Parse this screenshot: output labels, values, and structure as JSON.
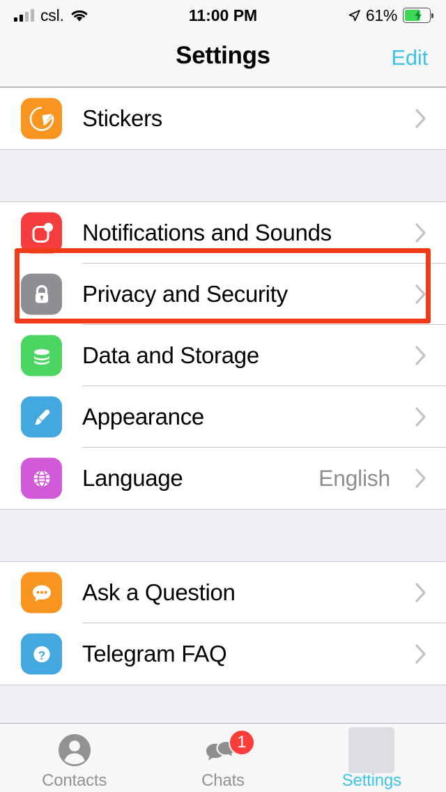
{
  "status_bar": {
    "carrier": "csl.",
    "time": "11:00 PM",
    "battery_percent": "61%",
    "signal_bars_filled": 2,
    "signal_bars_total": 4,
    "icons": [
      "signal-bars-icon",
      "wifi-icon",
      "location-arrow-icon",
      "battery-charging-icon"
    ]
  },
  "nav": {
    "title": "Settings",
    "edit_label": "Edit",
    "accent_color": "#3dc4e8"
  },
  "groups": [
    {
      "id": "group-stickers",
      "rows": [
        {
          "id": "stickers",
          "label": "Stickers",
          "value": "",
          "icon": "sticker-icon",
          "icon_color": "#f79520",
          "chevron": true
        }
      ]
    },
    {
      "id": "group-main",
      "rows": [
        {
          "id": "notifications-and-sounds",
          "label": "Notifications and Sounds",
          "value": "",
          "icon": "notification-bell-icon",
          "icon_color": "#f53d3d",
          "chevron": true
        },
        {
          "id": "privacy-and-security",
          "label": "Privacy and Security",
          "value": "",
          "icon": "lock-icon",
          "icon_color": "#8e8e93",
          "chevron": true,
          "highlighted": true
        },
        {
          "id": "data-and-storage",
          "label": "Data and Storage",
          "value": "",
          "icon": "database-icon",
          "icon_color": "#4cd562",
          "chevron": true
        },
        {
          "id": "appearance",
          "label": "Appearance",
          "value": "",
          "icon": "paintbrush-icon",
          "icon_color": "#44a8e0",
          "chevron": true
        },
        {
          "id": "language",
          "label": "Language",
          "value": "English",
          "icon": "globe-icon",
          "icon_color": "#d25ad9",
          "chevron": true
        }
      ]
    },
    {
      "id": "group-help",
      "rows": [
        {
          "id": "ask-a-question",
          "label": "Ask a Question",
          "value": "",
          "icon": "chat-bubble-icon",
          "icon_color": "#f79520",
          "chevron": true
        },
        {
          "id": "telegram-faq",
          "label": "Telegram FAQ",
          "value": "",
          "icon": "question-mark-icon",
          "icon_color": "#44a8e0",
          "chevron": true
        }
      ]
    }
  ],
  "highlight": {
    "color": "#f03c18",
    "target": "privacy-and-security"
  },
  "tabs": [
    {
      "id": "contacts",
      "label": "Contacts",
      "icon": "person-icon",
      "active": false,
      "badge": ""
    },
    {
      "id": "chats",
      "label": "Chats",
      "icon": "chat-bubbles-icon",
      "active": false,
      "badge": "1"
    },
    {
      "id": "settings",
      "label": "Settings",
      "icon": "gear-placeholder-icon",
      "active": true,
      "badge": ""
    }
  ]
}
